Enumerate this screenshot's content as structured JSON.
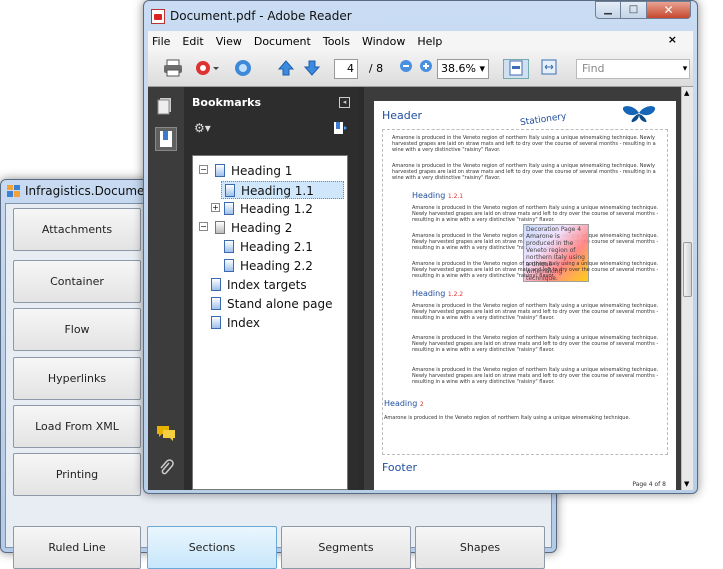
{
  "back_window": {
    "title": "Infragistics.Documents.Re",
    "left_buttons": [
      "Attachments",
      "Container",
      "Flow",
      "Hyperlinks",
      "Load From XML",
      "Printing"
    ],
    "bottom_buttons": [
      "Ruled Line",
      "Sections",
      "Segments",
      "Shapes"
    ],
    "selected_bottom": "Sections"
  },
  "front_window": {
    "title": "Document.pdf - Adobe Reader",
    "menu": [
      "File",
      "Edit",
      "View",
      "Document",
      "Tools",
      "Window",
      "Help"
    ],
    "close_x": "×",
    "page_current": "4",
    "page_total": "/ 8",
    "zoom": "38.6%",
    "find_placeholder": "Find",
    "bookmarks": {
      "title": "Bookmarks",
      "items": [
        "Heading 1",
        "Heading 1.1",
        "Heading 1.2",
        "Heading 2",
        "Heading 2.1",
        "Heading 2.2",
        "Index targets",
        "Stand alone page",
        "Index"
      ],
      "selected": "Heading 1.1"
    },
    "page": {
      "header": "Header",
      "stationery": "Stationery",
      "para": "Amarone is produced in the Veneto region of northern Italy using a unique winemaking technique. Newly harvested grapes are laid on straw mats and left to dry over the course of several months - resulting in a wine with a very distinctive \"raisiny\" flavor.",
      "para_single": "Amarone is produced in the Veneto region of northern Italy using a unique winemaking technique.",
      "heading_a": "Heading",
      "heading_a_num": "1.2.1",
      "heading_b": "Heading",
      "heading_b_num": "1.2.2",
      "heading_c": "Heading",
      "heading_c_num": "2",
      "decoration": "Decoration Page 4 Amarone is produced in the Veneto region of northern Italy using a unique winemaking technique.",
      "footer": "Footer",
      "page_num": "Page 4 of 8"
    }
  },
  "colors": {
    "heading_blue": "#1f4e9c",
    "heading_num_red": "#dd3333",
    "selection": "#cfe6fb"
  }
}
